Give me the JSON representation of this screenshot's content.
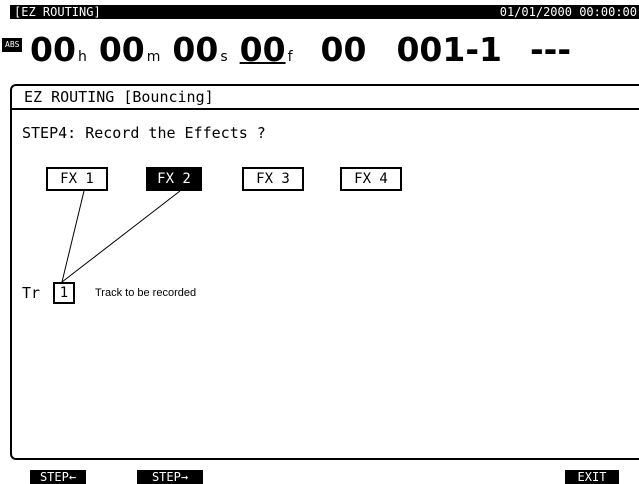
{
  "header": {
    "title": "[EZ ROUTING]",
    "datetime": "01/01/2000 00:00:00"
  },
  "counter": {
    "badge": "ABS",
    "hours": "00",
    "hours_unit": "h",
    "minutes": "00",
    "minutes_unit": "m",
    "seconds": "00",
    "seconds_unit": "s",
    "frames": "00",
    "frames_unit": "f",
    "subframes": "00",
    "measure": "001-1",
    "marker": "---"
  },
  "panel": {
    "title": "EZ ROUTING [Bouncing]",
    "step": "STEP4: Record the Effects ?",
    "effects": [
      {
        "label": "FX 1",
        "selected": false
      },
      {
        "label": "FX 2",
        "selected": true
      },
      {
        "label": "FX 3",
        "selected": false
      },
      {
        "label": "FX 4",
        "selected": false
      }
    ],
    "track_prefix": "Tr",
    "track_number": "1",
    "track_note": "Track to be recorded"
  },
  "function_keys": {
    "step_back": "STEP←",
    "step_forward": "STEP→",
    "exit": "EXIT"
  }
}
